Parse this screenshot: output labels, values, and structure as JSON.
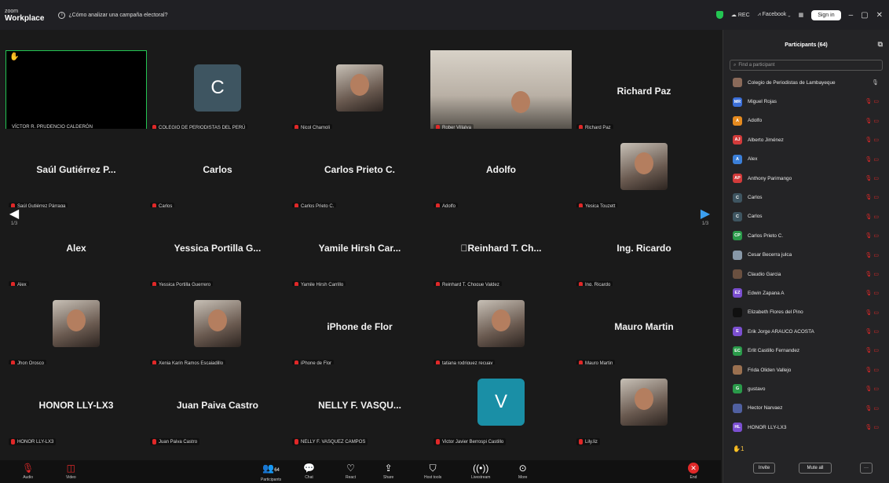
{
  "titlebar": {
    "logo_top": "zoom",
    "logo_bottom": "Workplace",
    "info": "¿Cómo analizar una campaña electoral?",
    "rec": "REC",
    "facebook": "Facebook",
    "signin": "Sign in",
    "minimize": "–",
    "maximize": "▢",
    "close": "✕"
  },
  "tiles": [
    {
      "name": "VÍCTOR R. PRUDENCIO CALDERÓN",
      "kind": "black",
      "big": ""
    },
    {
      "name": "COLEGIO DE PERIODISTAS DEL PERÚ",
      "kind": "initial",
      "big": "C",
      "color": "#3e5561"
    },
    {
      "name": "Nicol Chamoli",
      "kind": "photo",
      "big": ""
    },
    {
      "name": "Rober Villalva",
      "kind": "video",
      "big": ""
    },
    {
      "name": "Richard Paz",
      "kind": "text",
      "big": "Richard Paz"
    },
    {
      "name": "Saúl Gutiérrez Párraga",
      "kind": "text",
      "big": "Saúl Gutiérrez P..."
    },
    {
      "name": "Carlos",
      "kind": "text",
      "big": "Carlos"
    },
    {
      "name": "Carlos Prieto C.",
      "kind": "text",
      "big": "Carlos Prieto C."
    },
    {
      "name": "Adolfo",
      "kind": "text",
      "big": "Adolfo"
    },
    {
      "name": "Yesica Touzett",
      "kind": "photo",
      "big": ""
    },
    {
      "name": "Alex",
      "kind": "text",
      "big": "Alex"
    },
    {
      "name": "Yessica Portilla Guerrero",
      "kind": "text",
      "big": "Yessica Portilla G..."
    },
    {
      "name": "Yamile Hirsh Carrillo",
      "kind": "text",
      "big": "Yamile Hirsh Car..."
    },
    {
      "name": "Reinhard T. Choque Valdez",
      "kind": "text",
      "big": "\u0000Reinhard T. Ch..."
    },
    {
      "name": "Ing. Ricardo",
      "kind": "text",
      "big": "Ing. Ricardo"
    },
    {
      "name": "Jhon Orosco",
      "kind": "photo",
      "big": ""
    },
    {
      "name": "Xenia Karin Ramos Escajadillo",
      "kind": "photo",
      "big": ""
    },
    {
      "name": "iPhone de Flor",
      "kind": "text",
      "big": "iPhone de Flor"
    },
    {
      "name": "tatiana rodriguez recuay",
      "kind": "photo",
      "big": ""
    },
    {
      "name": "Mauro Martin",
      "kind": "text",
      "big": "Mauro Martin"
    },
    {
      "name": "HONOR LLY-LX3",
      "kind": "text",
      "big": "HONOR LLY-LX3"
    },
    {
      "name": "Juan Paiva Castro",
      "kind": "text",
      "big": "Juan Paiva Castro"
    },
    {
      "name": "NELLY F. VASQUEZ CAMPOS",
      "kind": "text",
      "big": "NELLY F. VASQU..."
    },
    {
      "name": "Victor Javier Berrospi Castillo",
      "kind": "initial",
      "big": "V",
      "color": "#1a8fa6"
    },
    {
      "name": "Lily.liz",
      "kind": "photo",
      "big": ""
    }
  ],
  "nav": {
    "left_page": "1/3",
    "right_page": "1/3"
  },
  "toolbar": {
    "audio": "Audio",
    "video": "Video",
    "participants": "Participants",
    "participants_count": "64",
    "chat": "Chat",
    "react": "React",
    "share": "Share",
    "host_tools": "Host tools",
    "livestream": "Livestream",
    "more": "More",
    "end": "End"
  },
  "panel": {
    "title": "Participants (64)",
    "search_placeholder": "Find a participant",
    "participants": [
      {
        "initials": "",
        "name": "Colegio de Periodistas de Lambayeque",
        "color": "#8a6a5a"
      },
      {
        "initials": "MR",
        "name": "Miguel Rojas",
        "color": "#3b6fd8"
      },
      {
        "initials": "A",
        "name": "Adolfo",
        "color": "#e58a1f"
      },
      {
        "initials": "AJ",
        "name": "Alberto Jiménez",
        "color": "#d23b3b"
      },
      {
        "initials": "A",
        "name": "Alex",
        "color": "#3b7fd8"
      },
      {
        "initials": "AP",
        "name": "Anthony Parimango",
        "color": "#d23b3b"
      },
      {
        "initials": "C",
        "name": "Carlos",
        "color": "#3e5561"
      },
      {
        "initials": "C",
        "name": "Carlos",
        "color": "#3e5561"
      },
      {
        "initials": "CP",
        "name": "Carlos Prieto C.",
        "color": "#2a9a4a"
      },
      {
        "initials": "",
        "name": "Cesar Becerra julca",
        "color": "#8898a8"
      },
      {
        "initials": "",
        "name": "Claudio Garcia",
        "color": "#6a5040"
      },
      {
        "initials": "EZ",
        "name": "Edwin Zapana A",
        "color": "#7b4fd0"
      },
      {
        "initials": "",
        "name": "Elizabeth Flores del Pino",
        "color": "#101010"
      },
      {
        "initials": "E",
        "name": "Erik Jorge ARAUCO ACOSTA",
        "color": "#7b4fd0"
      },
      {
        "initials": "EC",
        "name": "Erlit Castillo Fernandez",
        "color": "#2a9a4a"
      },
      {
        "initials": "",
        "name": "Frida Oliden Vallejo",
        "color": "#9a7050"
      },
      {
        "initials": "G",
        "name": "gustavo",
        "color": "#2a9a4a"
      },
      {
        "initials": "",
        "name": "Hector Narvaez",
        "color": "#5060a0"
      },
      {
        "initials": "HL",
        "name": "HONOR LLY-LX3",
        "color": "#7b4fd0"
      },
      {
        "initials": "",
        "name": "Ing. Ricardo",
        "color": "#2a9a4a"
      }
    ],
    "raised_hands": "1",
    "invite": "Invite",
    "mute_all": "Mute all",
    "more": "···"
  }
}
